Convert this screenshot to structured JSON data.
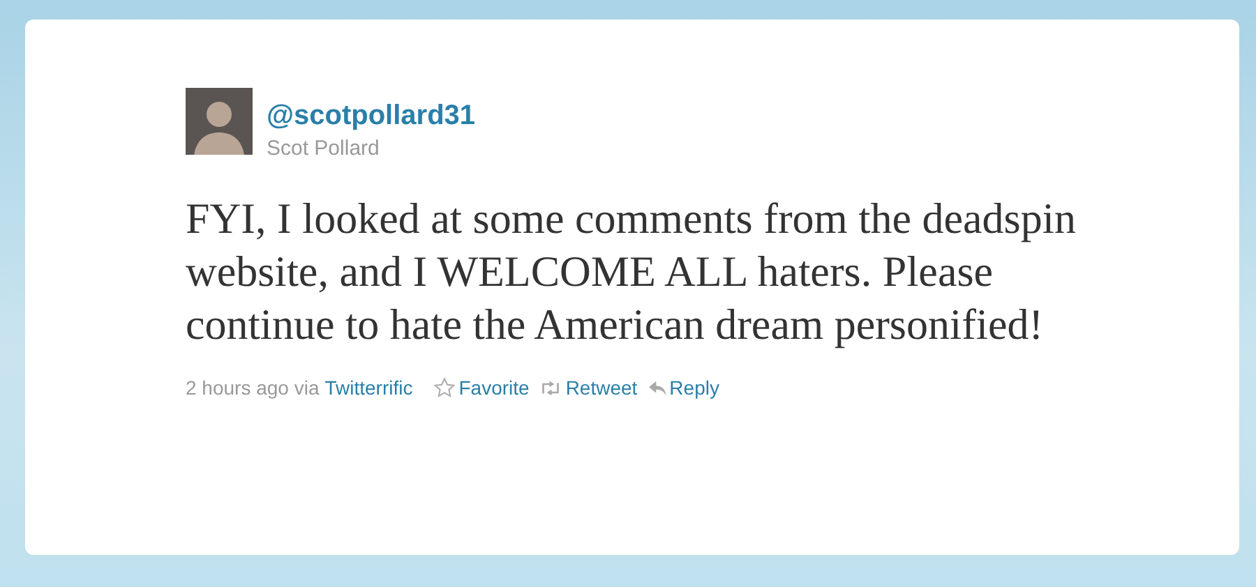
{
  "tweet": {
    "handle": "@scotpollard31",
    "name": "Scot Pollard",
    "text": "FYI, I looked at some comments from the deadspin website, and I WELCOME ALL haters. Please continue to hate the American dream personified!",
    "timestamp": "2 hours ago via",
    "source": "Twitterrific",
    "actions": [
      {
        "kind": "favorite",
        "label": "Favorite"
      },
      {
        "kind": "retweet",
        "label": "Retweet"
      },
      {
        "kind": "reply",
        "label": "Reply"
      }
    ]
  }
}
